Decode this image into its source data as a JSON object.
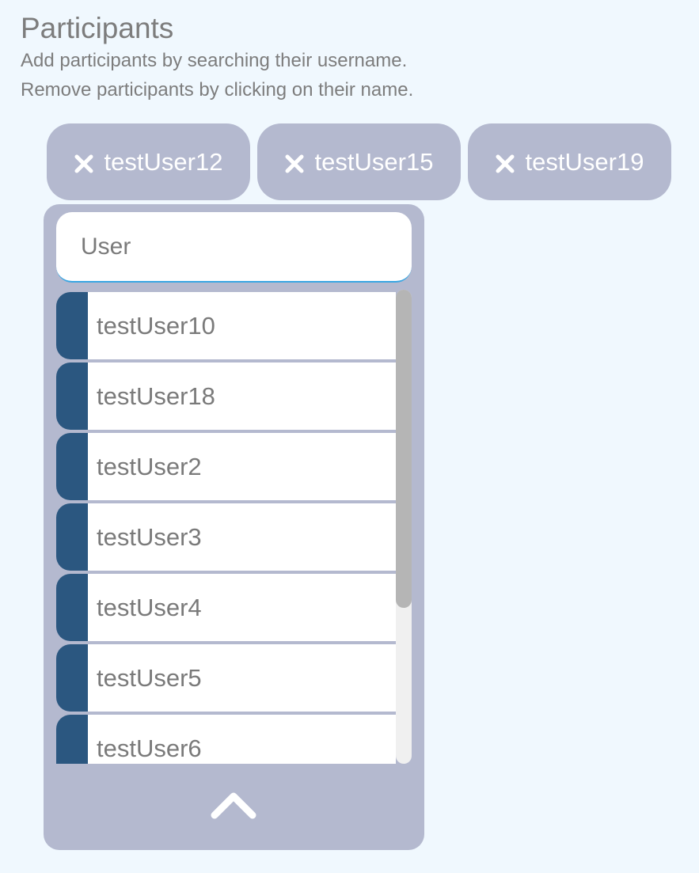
{
  "header": {
    "title": "Participants",
    "line1": "Add participants by searching their username.",
    "line2": "Remove participants by clicking on their name."
  },
  "selected": [
    {
      "name": "testUser12",
      "icon": "close-icon"
    },
    {
      "name": "testUser15",
      "icon": "close-icon"
    },
    {
      "name": "testUser19",
      "icon": "close-icon"
    }
  ],
  "search": {
    "value": "User"
  },
  "results": [
    "testUser10",
    "testUser18",
    "testUser2",
    "testUser3",
    "testUser4",
    "testUser5",
    "testUser6"
  ],
  "collapse": {
    "icon": "chevron-up-icon"
  },
  "colors": {
    "background": "#f0f8fe",
    "chip": "#b4b9cf",
    "accent": "#2b5780",
    "focus_underline": "#3aa6e2"
  }
}
